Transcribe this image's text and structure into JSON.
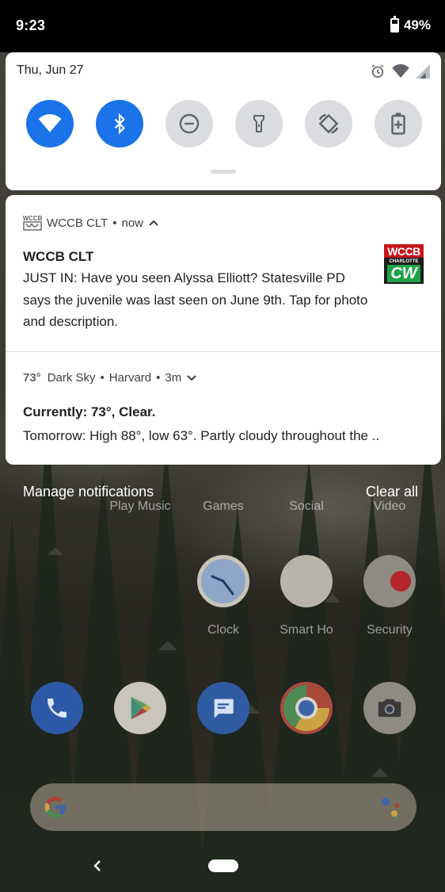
{
  "status_bar": {
    "time": "9:23",
    "battery": "49%"
  },
  "quick_settings": {
    "date": "Thu, Jun 27",
    "tiles": [
      {
        "name": "wifi",
        "on": true
      },
      {
        "name": "bluetooth",
        "on": true
      },
      {
        "name": "do-not-disturb",
        "on": false
      },
      {
        "name": "flashlight",
        "on": false
      },
      {
        "name": "auto-rotate",
        "on": false
      },
      {
        "name": "battery-saver",
        "on": false
      }
    ]
  },
  "notifications": [
    {
      "app": "WCCB CLT",
      "time": "now",
      "title": "WCCB CLT",
      "body": "JUST IN: Have you seen Alyssa Elliott? Statesville PD says the juvenile was last seen on June 9th. Tap for photo and description.",
      "thumb_top": "WCCB",
      "thumb_mid": "CHARLOTTE",
      "thumb_logo": "CW",
      "icon_text": "WCCB"
    },
    {
      "temp_badge": "73°",
      "app": "Dark Sky",
      "subtext": "Harvard",
      "time": "3m",
      "title": "Currently: 73°, Clear.",
      "body": "Tomorrow: High 88°, low 63°. Partly cloudy throughout the .."
    }
  ],
  "actions": {
    "manage": "Manage notifications",
    "clear_all": "Clear all"
  },
  "home": {
    "row1_labels": [
      "Play Music",
      "Games",
      "Social",
      "Video"
    ],
    "row2_labels": [
      "Clock",
      "Smart Ho",
      "Security"
    ]
  },
  "colors": {
    "accent": "#1a73e8",
    "tile_off": "#dadce0",
    "wccb_red": "#c4161c"
  }
}
